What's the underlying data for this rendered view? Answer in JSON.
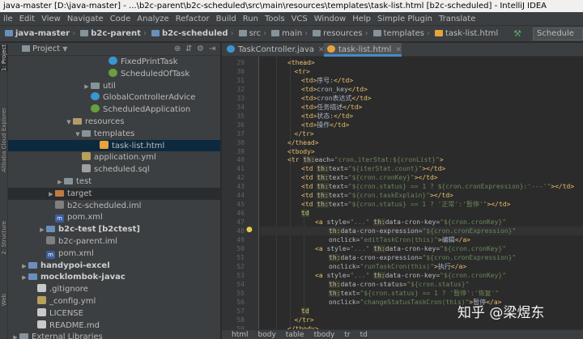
{
  "window": {
    "title": "java-master [D:\\java-master] - ...\\b2c-parent\\b2c-scheduled\\src\\main\\resources\\templates\\task-list.html [b2c-scheduled] - IntelliJ IDEA"
  },
  "menu": [
    "ile",
    "Edit",
    "View",
    "Navigate",
    "Code",
    "Analyze",
    "Refactor",
    "Build",
    "Run",
    "Tools",
    "VCS",
    "Window",
    "Help",
    "Simple Plugin",
    "Translate"
  ],
  "nav": {
    "crumbs": [
      "java-master",
      "b2c-parent",
      "b2c-scheduled",
      "src",
      "main",
      "resources",
      "templates",
      "task-list.html"
    ],
    "run_config": "Schedule"
  },
  "side_tabs": [
    "1: Project",
    "Alibaba Cloud Explorer",
    "2: Structure",
    "Web"
  ],
  "project_panel": {
    "title": "Project",
    "tree": [
      {
        "label": "FixedPrintTask",
        "indent": 10,
        "arrow": "",
        "icon": "class"
      },
      {
        "label": "ScheduledOfTask",
        "indent": 10,
        "arrow": "",
        "icon": "spring"
      },
      {
        "label": "util",
        "indent": 8,
        "arrow": "▶",
        "icon": "folder"
      },
      {
        "label": "GlobalControllerAdvice",
        "indent": 8,
        "arrow": "",
        "icon": "class"
      },
      {
        "label": "ScheduledApplication",
        "indent": 8,
        "arrow": "",
        "icon": "spring"
      },
      {
        "label": "resources",
        "indent": 6,
        "arrow": "▼",
        "icon": "resfolder"
      },
      {
        "label": "templates",
        "indent": 7,
        "arrow": "▼",
        "icon": "folder"
      },
      {
        "label": "task-list.html",
        "indent": 9,
        "arrow": "",
        "icon": "html",
        "selected": true
      },
      {
        "label": "application.yml",
        "indent": 7,
        "arrow": "",
        "icon": "yml"
      },
      {
        "label": "scheduled.sql",
        "indent": 7,
        "arrow": "",
        "icon": "sql"
      },
      {
        "label": "test",
        "indent": 5,
        "arrow": "▶",
        "icon": "folder"
      },
      {
        "label": "target",
        "indent": 4,
        "arrow": "▶",
        "icon": "target",
        "highlight": true
      },
      {
        "label": "b2c-scheduled.iml",
        "indent": 4,
        "arrow": "",
        "icon": "iml"
      },
      {
        "label": "pom.xml",
        "indent": 4,
        "arrow": "",
        "icon": "maven"
      },
      {
        "label": "b2c-test",
        "extra": "[b2ctest]",
        "indent": 3,
        "arrow": "▶",
        "icon": "module",
        "bold": true
      },
      {
        "label": "b2c-parent.iml",
        "indent": 3,
        "arrow": "",
        "icon": "iml"
      },
      {
        "label": "pom.xml",
        "indent": 3,
        "arrow": "",
        "icon": "maven"
      },
      {
        "label": "handypoi-excel",
        "indent": 1,
        "arrow": "▶",
        "icon": "module",
        "bold": true
      },
      {
        "label": "mocklombok-javac",
        "indent": 1,
        "arrow": "▶",
        "icon": "module",
        "bold": true
      },
      {
        "label": ".gitignore",
        "indent": 2,
        "arrow": "",
        "icon": "txt"
      },
      {
        "label": "_config.yml",
        "indent": 2,
        "arrow": "",
        "icon": "yml"
      },
      {
        "label": "LICENSE",
        "indent": 2,
        "arrow": "",
        "icon": "txt"
      },
      {
        "label": "README.md",
        "indent": 2,
        "arrow": "",
        "icon": "txt"
      },
      {
        "label": "External Libraries",
        "indent": 0,
        "arrow": "▶",
        "icon": "folder"
      }
    ]
  },
  "editor_tabs": [
    {
      "label": "TaskController.java",
      "icon": "class",
      "active": false
    },
    {
      "label": "task-list.html",
      "icon": "html",
      "active": true
    }
  ],
  "editor": {
    "first_line": 29,
    "current_line": 48,
    "bulb_line": 48,
    "lines": [
      [
        [
          4,
          ""
        ],
        [
          "tg",
          "<thead>"
        ]
      ],
      [
        [
          5,
          ""
        ],
        [
          "tg",
          "<tr>"
        ]
      ],
      [
        [
          6,
          ""
        ],
        [
          "tg",
          "<td>"
        ],
        [
          "tx",
          "序号:"
        ],
        [
          "tg",
          "</td>"
        ]
      ],
      [
        [
          6,
          ""
        ],
        [
          "tg",
          "<td>"
        ],
        [
          "tx",
          "cron_key"
        ],
        [
          "tg",
          "</td>"
        ]
      ],
      [
        [
          6,
          ""
        ],
        [
          "tg",
          "<td>"
        ],
        [
          "tx",
          "cron表达式"
        ],
        [
          "tg",
          "</td>"
        ]
      ],
      [
        [
          6,
          ""
        ],
        [
          "tg",
          "<td>"
        ],
        [
          "tx",
          "任务描述"
        ],
        [
          "tg",
          "</td>"
        ]
      ],
      [
        [
          6,
          ""
        ],
        [
          "tg",
          "<td>"
        ],
        [
          "tx",
          "状态:"
        ],
        [
          "tg",
          "</td>"
        ]
      ],
      [
        [
          6,
          ""
        ],
        [
          "tg",
          "<td>"
        ],
        [
          "tx",
          "操作"
        ],
        [
          "tg",
          "</td>"
        ]
      ],
      [
        [
          5,
          ""
        ],
        [
          "tg",
          "</tr>"
        ]
      ],
      [
        [
          4,
          ""
        ],
        [
          "tg",
          "</thead>"
        ]
      ],
      [
        [
          4,
          ""
        ],
        [
          "tg",
          "<tbody>"
        ]
      ],
      [
        [
          4,
          ""
        ],
        [
          "tg",
          "<tr "
        ],
        [
          "th",
          "th:"
        ],
        [
          "at",
          "each="
        ],
        [
          "av",
          "\"cron,iterStat:${cronList}\""
        ],
        [
          "tg",
          ">"
        ]
      ],
      [
        [
          6,
          ""
        ],
        [
          "tg",
          "<td "
        ],
        [
          "th",
          "th:"
        ],
        [
          "at",
          "text="
        ],
        [
          "av",
          "\"${iterStat.count}\""
        ],
        [
          "tg",
          "></td>"
        ]
      ],
      [
        [
          6,
          ""
        ],
        [
          "tg",
          "<td "
        ],
        [
          "th",
          "th:"
        ],
        [
          "at",
          "text="
        ],
        [
          "av",
          "\"${cron.cronKey}\""
        ],
        [
          "tg",
          "></td>"
        ]
      ],
      [
        [
          6,
          ""
        ],
        [
          "tg",
          "<td "
        ],
        [
          "th",
          "th:"
        ],
        [
          "at",
          "text="
        ],
        [
          "av",
          "\"${cron.status} == 1 ? ${cron.cronExpression}:'---'\""
        ],
        [
          "tg",
          "></td>"
        ]
      ],
      [
        [
          6,
          ""
        ],
        [
          "tg",
          "<td "
        ],
        [
          "th",
          "th:"
        ],
        [
          "at",
          "text="
        ],
        [
          "av",
          "\"${cron.taskExplain}\""
        ],
        [
          "tg",
          "></td>"
        ]
      ],
      [
        [
          6,
          ""
        ],
        [
          "tg",
          "<td "
        ],
        [
          "th",
          "th:"
        ],
        [
          "at",
          "text="
        ],
        [
          "av",
          "\"${cron.status} == 1 ? '正常':'暂停'\""
        ],
        [
          "tg",
          "></td>"
        ]
      ],
      [
        [
          6,
          ""
        ],
        [
          "ct",
          "td"
        ]
      ],
      [
        [
          8,
          ""
        ],
        [
          "tg",
          "<a "
        ],
        [
          "at",
          "style="
        ],
        [
          "av",
          "\"...\" "
        ],
        [
          "th",
          "th:"
        ],
        [
          "at",
          "data-cron-key="
        ],
        [
          "av",
          "\"${cron.cronKey}\""
        ]
      ],
      [
        [
          10,
          ""
        ],
        [
          "th",
          "th:"
        ],
        [
          "at",
          "data-cron-expression="
        ],
        [
          "av",
          "\"${cron.cronExpression}\""
        ]
      ],
      [
        [
          10,
          ""
        ],
        [
          "at",
          "onclick="
        ],
        [
          "av",
          "\"editTaskCron(this)\""
        ],
        [
          "tg",
          ">"
        ],
        [
          "tx",
          "编辑"
        ],
        [
          "tg",
          "</a>"
        ]
      ],
      [
        [
          8,
          ""
        ],
        [
          "tg",
          "<a "
        ],
        [
          "at",
          "style="
        ],
        [
          "av",
          "\"...\" "
        ],
        [
          "th",
          "th:"
        ],
        [
          "at",
          "data-cron-key="
        ],
        [
          "av",
          "\"${cron.cronKey}\""
        ]
      ],
      [
        [
          10,
          ""
        ],
        [
          "th",
          "th:"
        ],
        [
          "at",
          "data-cron-expression="
        ],
        [
          "av",
          "\"${cron.cronExpression}\""
        ]
      ],
      [
        [
          10,
          ""
        ],
        [
          "at",
          "onclick="
        ],
        [
          "av",
          "\"runTaskCron(this)\""
        ],
        [
          "tg",
          ">"
        ],
        [
          "tx",
          "执行"
        ],
        [
          "tg",
          "</a>"
        ]
      ],
      [
        [
          8,
          ""
        ],
        [
          "tg",
          "<a "
        ],
        [
          "at",
          "style="
        ],
        [
          "av",
          "\"...\" "
        ],
        [
          "th",
          "th:"
        ],
        [
          "at",
          "data-cron-key="
        ],
        [
          "av",
          "\"${cron.cronKey}\""
        ]
      ],
      [
        [
          10,
          ""
        ],
        [
          "th",
          "th:"
        ],
        [
          "at",
          "data-cron-status="
        ],
        [
          "av",
          "\"${cron.status}\""
        ]
      ],
      [
        [
          10,
          ""
        ],
        [
          "th",
          "th:"
        ],
        [
          "at",
          "text="
        ],
        [
          "av",
          "\"${cron.status} == 1 ? '暂停':'恢复'\""
        ]
      ],
      [
        [
          10,
          ""
        ],
        [
          "at",
          "onclick="
        ],
        [
          "av",
          "\"changeStatusTaskCron(this)\""
        ],
        [
          "tg",
          ">"
        ],
        [
          "tx",
          "暂停"
        ],
        [
          "tg",
          "</a>"
        ]
      ],
      [
        [
          6,
          ""
        ],
        [
          "ct",
          "td"
        ]
      ],
      [
        [
          5,
          ""
        ],
        [
          "tg",
          "</tr>"
        ]
      ],
      [
        [
          4,
          ""
        ],
        [
          "tg",
          "</tbody>"
        ]
      ],
      [
        [
          3,
          ""
        ],
        [
          "tg",
          "</table>"
        ]
      ]
    ]
  },
  "breadcrumb": [
    "html",
    "body",
    "table",
    "tbody",
    "tr",
    "td"
  ],
  "watermark": "知乎 @梁煜东"
}
